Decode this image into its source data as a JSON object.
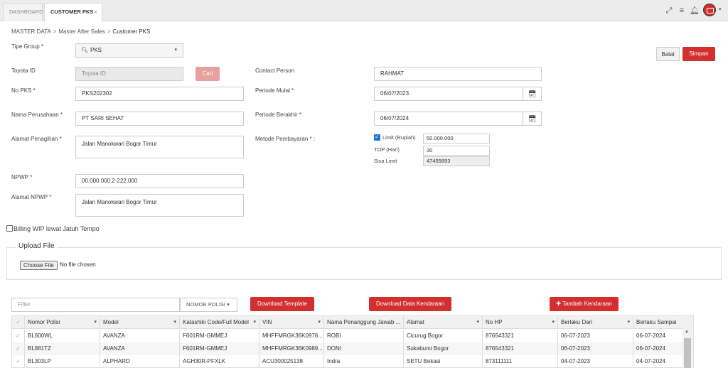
{
  "tabs": [
    {
      "label": "DASHBOARD"
    },
    {
      "label": "CUSTOMER PKS",
      "close": "×"
    }
  ],
  "topbar_icons": [
    "expand-icon",
    "menu-icon",
    "bell-icon",
    "user-avatar"
  ],
  "breadcrumb": [
    "MASTER DATA",
    "Master After Sales",
    "Customer PKS"
  ],
  "form": {
    "tipe_group": {
      "label": "Tipe Group *",
      "value": "PKS"
    },
    "toyota_id": {
      "label": "Toyota ID",
      "placeholder": "Toyota ID",
      "search_label": "Cari"
    },
    "no_pks": {
      "label": "No PKS *",
      "value": "PKS202302"
    },
    "nama_perusahaan": {
      "label": "Nama Perusahaan *",
      "value": "PT SARI SEHAT"
    },
    "alamat_penagihan": {
      "label": "Alamat Penagihan *",
      "value": "Jalan Manokwari Bogor Timur"
    },
    "npwp": {
      "label": "NPWP *",
      "value": "00.000.000.2-222.000"
    },
    "alamat_npwp": {
      "label": "Alamat NPWP *",
      "value": "Jalan Manokwari Bogor Timur"
    },
    "contact_person": {
      "label": "Contact Person",
      "value": "RAHMAT"
    },
    "periode_mulai": {
      "label": "Periode Mulai *",
      "value": "06/07/2023"
    },
    "periode_berakhir": {
      "label": "Periode Berakhir *",
      "value": "06/07/2024"
    },
    "metode_pembayaran": {
      "label": "Metode Pembayaran * :",
      "limit_label": "Limit (Rupiah)",
      "limit_value": "50.000.000",
      "limit_checked": true,
      "top_label": "TOP (Hari)",
      "top_value": "30",
      "sisa_label": "Sisa Limit",
      "sisa_value": "47455893"
    },
    "billing_wip": {
      "label": "Billing WIP lewat Jatuh Tempo",
      "checked": false
    }
  },
  "actions": {
    "batal": "Batal",
    "simpan": "Simpan"
  },
  "upload": {
    "legend": "Upload File",
    "choose": "Choose File",
    "status": "No file chosen"
  },
  "table_tools": {
    "filter_placeholder": "Filter",
    "filter_field": "NOMOR POLISI ▾",
    "download_template": "Download Template",
    "download_data": "Download Data Kendaraan",
    "tambah": "✚ Tambah Kendaraan"
  },
  "grid": {
    "columns": [
      "Nomor Polisi",
      "Model",
      "Katashiki Code/Full Model",
      "VIN",
      "Nama Penanggung Jawab ...",
      "Alamat",
      "No HP",
      "Berlaku Dari",
      "Berlaku Sampai"
    ],
    "rows": [
      [
        "BL600WL",
        "AVANZA",
        "F601RM-GMMEJ",
        "MHFFMRGK36K0976...",
        "ROBI",
        "Cicurug Bogor",
        "876543321",
        "06-07-2023",
        "06-07-2024"
      ],
      [
        "BL881TZ",
        "AVANZA",
        "F601RM-GMMEJ",
        "MHFFMRGK36K0989...",
        "DONI",
        "Sukabumi Bogor",
        "876543321",
        "06-07-2023",
        "06-07-2024"
      ],
      [
        "BL303LP",
        "ALPHARD",
        "AGH30R-PFXLK",
        "ACU300025138",
        "Indra",
        "SETU Bekasi",
        "873111111",
        "04-07-2023",
        "04-07-2024"
      ]
    ]
  },
  "colors": {
    "accent": "#d32f2f",
    "accent_disabled": "#e8a0a0",
    "checkbox": "#1e73d8"
  }
}
